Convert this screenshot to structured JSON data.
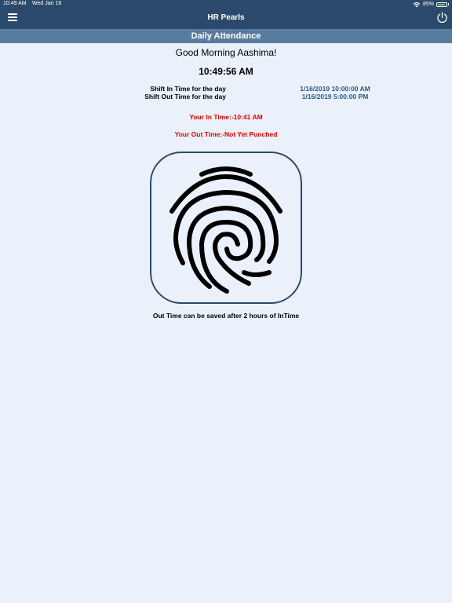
{
  "status_bar": {
    "time": "10:49 AM",
    "date": "Wed Jan 16",
    "battery_text": "85%",
    "battery_level": 0.85
  },
  "nav": {
    "title": "HR Pearls",
    "menu_icon": "hamburger-menu-icon",
    "power_icon": "power-icon"
  },
  "header": {
    "title": "Daily Attendance"
  },
  "main": {
    "greeting": "Good Morning Aashima!",
    "clock": "10:49:56 AM",
    "shift_in_label": "Shift In Time for the day",
    "shift_in_value": "1/16/2019 10:00:00 AM",
    "shift_out_label": "Shift Out Time for the day",
    "shift_out_value": "1/16/2019 5:00:00 PM",
    "in_time": "Your In Time:-10:41 AM",
    "out_time": "Your Out Time:-Not Yet Punched",
    "fingerprint_icon": "fingerprint-icon",
    "note": "Out Time can be saved after 2 hours of InTime"
  },
  "colors": {
    "nav_bg": "#2b4a6b",
    "subheader_bg": "#587ca0",
    "page_bg": "#eaf1fa",
    "alert_red": "#e00000",
    "value_blue": "#2b5a86"
  }
}
